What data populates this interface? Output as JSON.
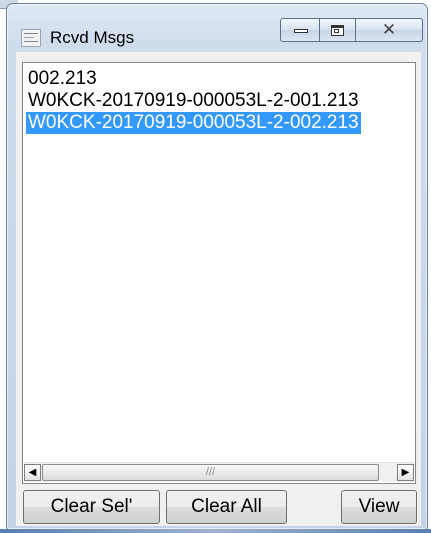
{
  "window": {
    "title": "Rcvd Msgs",
    "icon": "document-icon",
    "caption_buttons": {
      "minimize": "minimize-icon",
      "maximize": "maximize-icon",
      "close_glyph": "✕"
    }
  },
  "list": {
    "items": [
      {
        "text": "002.213",
        "selected": false
      },
      {
        "text": "W0KCK-20170919-000053L-2-001.213",
        "selected": false
      },
      {
        "text": "W0KCK-20170919-000053L-2-002.213",
        "selected": true
      }
    ],
    "selection_color": "#3399ff"
  },
  "scrollbar": {
    "left_arrow": "◀",
    "right_arrow": "▶",
    "grip": "///"
  },
  "buttons": {
    "clear_sel": "Clear Sel'",
    "clear_all": "Clear All",
    "view": "View"
  }
}
